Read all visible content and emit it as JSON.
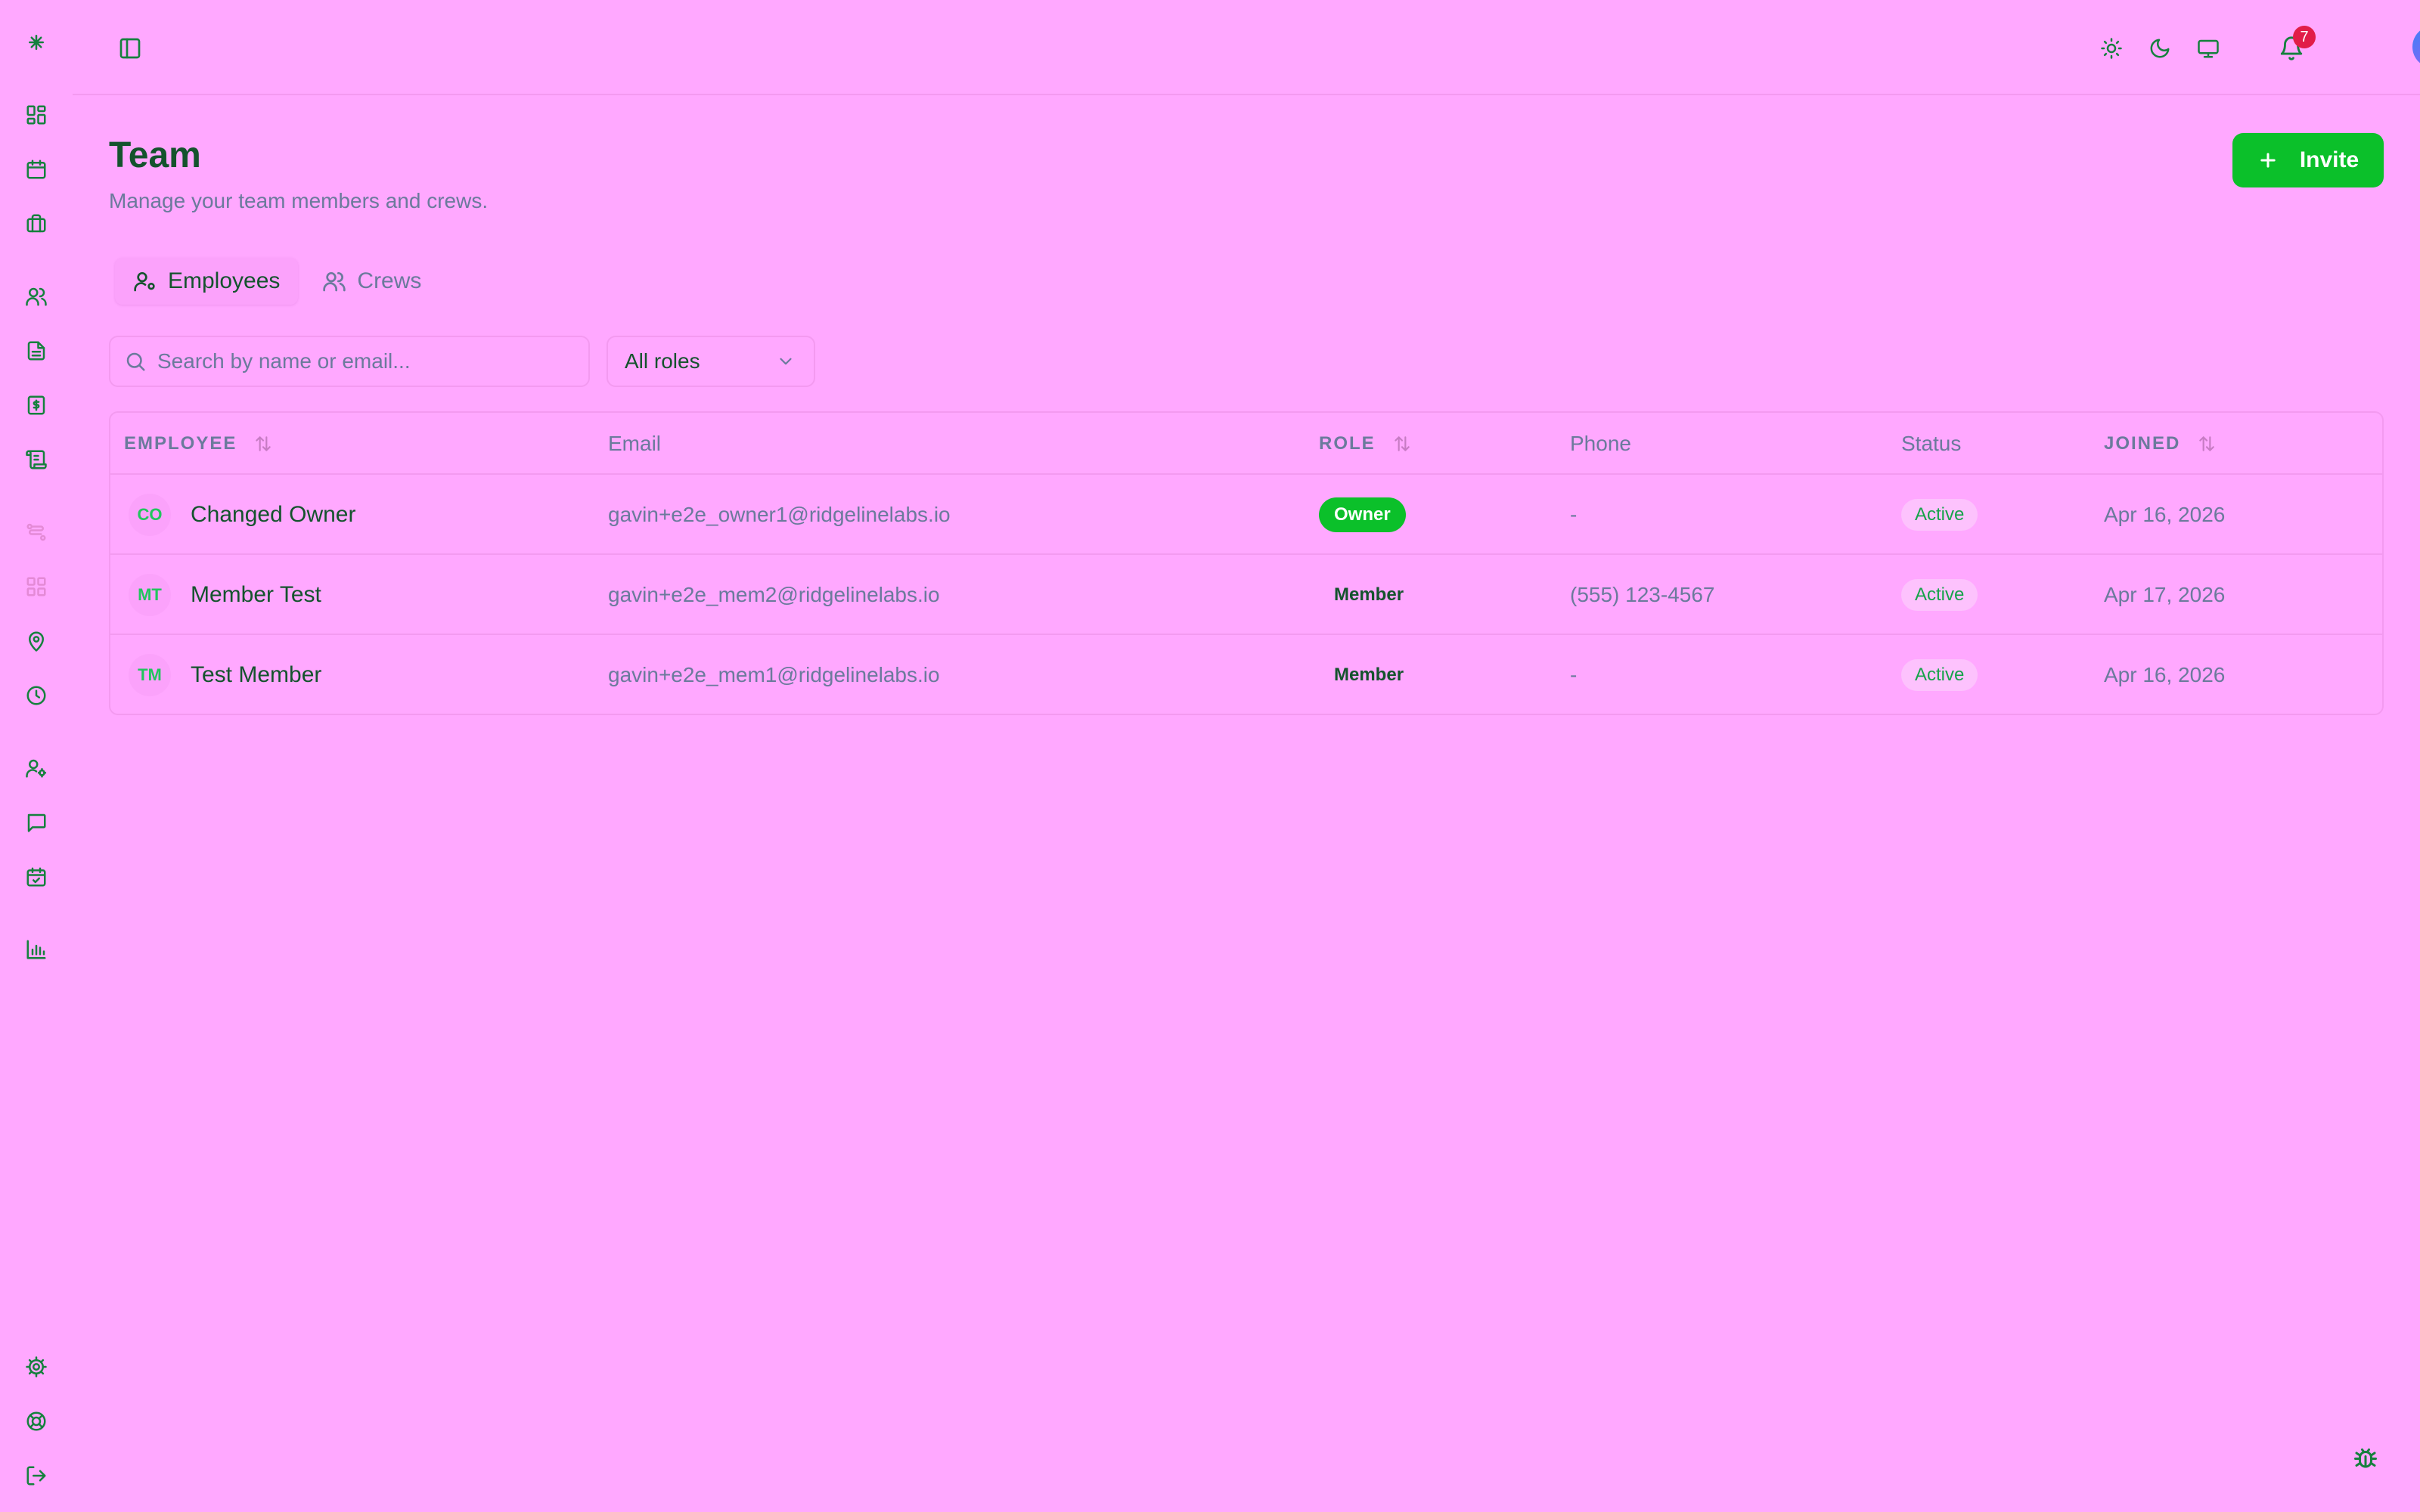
{
  "rail": {
    "items": [
      {
        "icon": "sparkle-logo-icon"
      },
      {
        "icon": "dashboard-icon"
      },
      {
        "icon": "calendar-icon"
      },
      {
        "icon": "briefcase-icon"
      },
      {
        "icon": "users-icon"
      },
      {
        "icon": "file-text-icon"
      },
      {
        "icon": "dollar-receipt-icon"
      },
      {
        "icon": "scroll-icon"
      },
      {
        "icon": "workflow-icon"
      },
      {
        "icon": "apps-grid-icon"
      },
      {
        "icon": "map-pin-icon"
      },
      {
        "icon": "clock-icon"
      },
      {
        "icon": "user-cog-icon"
      },
      {
        "icon": "message-icon"
      },
      {
        "icon": "calendar-check-icon"
      },
      {
        "icon": "bar-chart-icon"
      },
      {
        "icon": "settings-icon"
      },
      {
        "icon": "help-lifebuoy-icon"
      },
      {
        "icon": "logout-icon"
      }
    ]
  },
  "header": {
    "notifications_count": "7"
  },
  "page": {
    "title": "Team",
    "subtitle": "Manage your team members and crews.",
    "invite_label": "Invite"
  },
  "tabs": [
    {
      "label": "Employees",
      "active": true
    },
    {
      "label": "Crews",
      "active": false
    }
  ],
  "filters": {
    "search_placeholder": "Search by name or email...",
    "role_value": "All roles"
  },
  "table": {
    "headers": {
      "employee": "EMPLOYEE",
      "email": "Email",
      "role": "ROLE",
      "phone": "Phone",
      "status": "Status",
      "joined": "JOINED"
    },
    "rows": [
      {
        "initials": "CO",
        "name": "Changed Owner",
        "email": "gavin+e2e_owner1@ridgelinelabs.io",
        "role": "Owner",
        "phone": "-",
        "status": "Active",
        "joined": "Apr 16, 2026"
      },
      {
        "initials": "MT",
        "name": "Member Test",
        "email": "gavin+e2e_mem2@ridgelinelabs.io",
        "role": "Member",
        "phone": "(555) 123-4567",
        "status": "Active",
        "joined": "Apr 17, 2026"
      },
      {
        "initials": "TM",
        "name": "Test Member",
        "email": "gavin+e2e_mem1@ridgelinelabs.io",
        "role": "Member",
        "phone": "-",
        "status": "Active",
        "joined": "Apr 16, 2026"
      }
    ]
  },
  "colors": {
    "background": "#ffa8ff",
    "accent": "#0bc02a",
    "text_primary": "#14532d",
    "text_muted": "#6b7a9c",
    "notification_badge": "#e11d48"
  }
}
